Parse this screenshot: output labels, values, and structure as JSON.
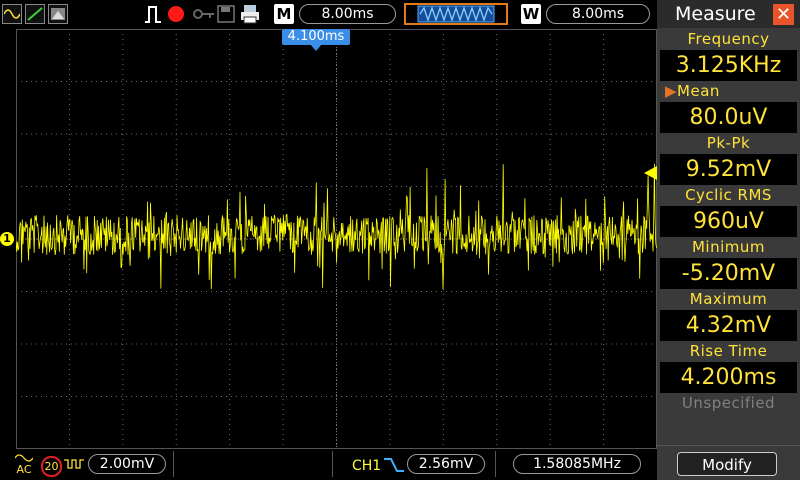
{
  "topbar": {
    "mode_icons": [
      "sine-wave-icon",
      "ramp-icon",
      "image-icon"
    ],
    "trigger_icon": "pulse-icon",
    "run_state_icon": "record-icon",
    "key_icon": "key-icon",
    "save_icon": "floppy-icon",
    "print_icon": "printer-icon",
    "timebase_label": "M",
    "timebase_value": "8.00ms",
    "window_label": "W",
    "window_value": "8.00ms"
  },
  "screen": {
    "trigger_time": "4.100ms",
    "channel_marker": "1"
  },
  "bottombar": {
    "coupling": "AC",
    "bw_limit": "20",
    "ch1_scale": "2.00mV",
    "trigger_source": "CH1",
    "trigger_level": "2.56mV",
    "frequency_counter": "1.58085MHz"
  },
  "measure": {
    "title": "Measure",
    "items": [
      {
        "label": "Frequency",
        "value": "3.125KHz"
      },
      {
        "label": "Mean",
        "value": "80.0uV"
      },
      {
        "label": "Pk-Pk",
        "value": "9.52mV"
      },
      {
        "label": "Cyclic RMS",
        "value": "960uV"
      },
      {
        "label": "Minimum",
        "value": "-5.20mV"
      },
      {
        "label": "Maximum",
        "value": "4.32mV"
      },
      {
        "label": "Rise Time",
        "value": "4.200ms"
      }
    ],
    "unspecified": "Unspecified",
    "modify_label": "Modify"
  },
  "colors": {
    "trace": "#ffff00",
    "accent": "#ffe23a",
    "trigger_blue": "#3a8ee8"
  }
}
